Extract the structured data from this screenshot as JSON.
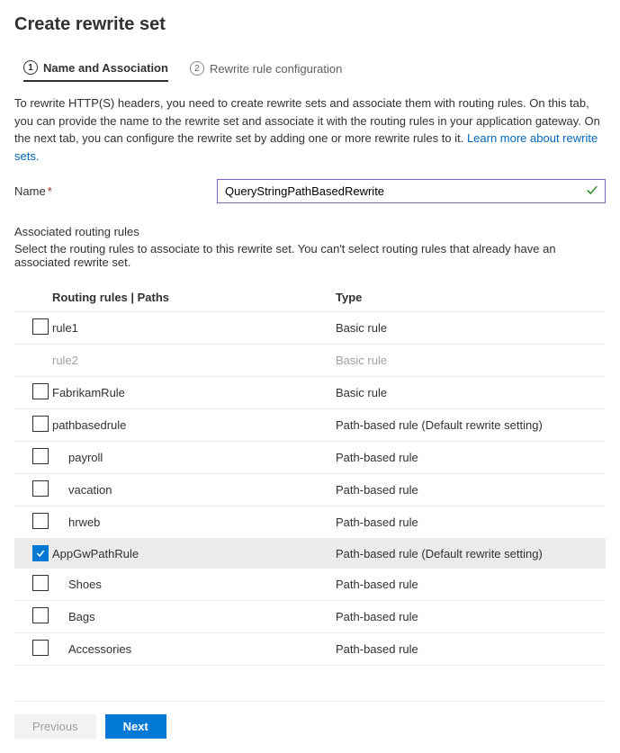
{
  "title": "Create rewrite set",
  "tabs": [
    {
      "num": "1",
      "label": "Name and Association"
    },
    {
      "num": "2",
      "label": "Rewrite rule configuration"
    }
  ],
  "description_part1": "To rewrite HTTP(S) headers, you need to create rewrite sets and associate them with routing rules. On this tab, you can provide the name to the rewrite set and associate it with the routing rules in your application gateway. On the next tab, you can configure the rewrite set by adding one or more rewrite rules to it. ",
  "learn_more": "Learn more about rewrite sets.",
  "name_label": "Name",
  "name_value": "QueryStringPathBasedRewrite",
  "assoc_title": "Associated routing rules",
  "assoc_sub": "Select the routing rules to associate to this rewrite set. You can't select routing rules that already have an associated rewrite set.",
  "col_name": "Routing rules | Paths",
  "col_type": "Type",
  "rows": [
    {
      "name": "rule1",
      "type": "Basic rule",
      "indent": false,
      "checked": false,
      "disabled": false
    },
    {
      "name": "rule2",
      "type": "Basic rule",
      "indent": false,
      "checked": false,
      "disabled": true
    },
    {
      "name": "FabrikamRule",
      "type": "Basic rule",
      "indent": false,
      "checked": false,
      "disabled": false
    },
    {
      "name": "pathbasedrule",
      "type": "Path-based rule (Default rewrite setting)",
      "indent": false,
      "checked": false,
      "disabled": false
    },
    {
      "name": "payroll",
      "type": "Path-based rule",
      "indent": true,
      "checked": false,
      "disabled": false
    },
    {
      "name": "vacation",
      "type": "Path-based rule",
      "indent": true,
      "checked": false,
      "disabled": false
    },
    {
      "name": "hrweb",
      "type": "Path-based rule",
      "indent": true,
      "checked": false,
      "disabled": false
    },
    {
      "name": "AppGwPathRule",
      "type": "Path-based rule (Default rewrite setting)",
      "indent": false,
      "checked": true,
      "disabled": false
    },
    {
      "name": "Shoes",
      "type": "Path-based rule",
      "indent": true,
      "checked": false,
      "disabled": false
    },
    {
      "name": "Bags",
      "type": "Path-based rule",
      "indent": true,
      "checked": false,
      "disabled": false
    },
    {
      "name": "Accessories",
      "type": "Path-based rule",
      "indent": true,
      "checked": false,
      "disabled": false
    }
  ],
  "buttons": {
    "prev": "Previous",
    "next": "Next"
  }
}
